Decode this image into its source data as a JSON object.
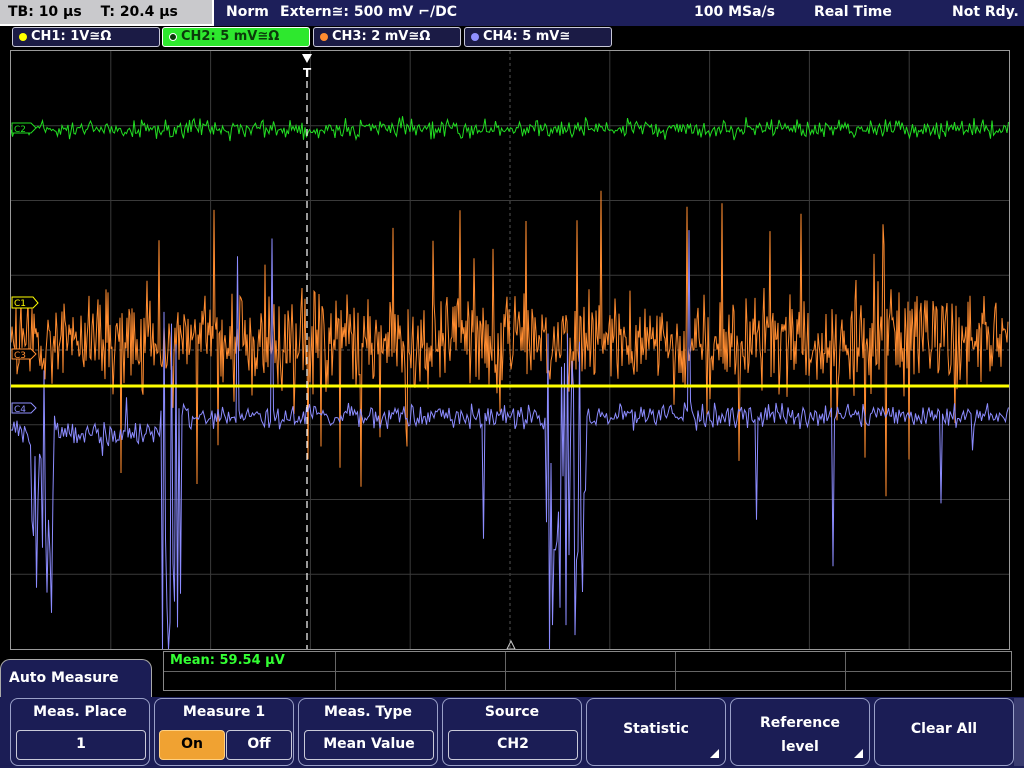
{
  "status_bar": {
    "timebase": "TB: 10 µs",
    "trigger_time": "T: 20.4 µs",
    "trigger_mode": "Norm",
    "trigger_source": "Extern≅: 500 mV ⌐/DC",
    "sample_rate": "100 MSa/s",
    "acquisition": "Real Time",
    "state": "Not Rdy."
  },
  "channels": [
    {
      "label": "CH1: 1V≅Ω",
      "color": "#ffff00",
      "active": false
    },
    {
      "label": "CH2: 5 mV≅Ω",
      "color": "#22dd22",
      "active": true
    },
    {
      "label": "CH3: 2 mV≅Ω",
      "color": "#ff8c30",
      "active": false
    },
    {
      "label": "CH4: 5 mV≅",
      "color": "#9090ff",
      "active": false
    }
  ],
  "markers": {
    "c2": "C2",
    "c1": "C1",
    "c3": "C3",
    "c4": "C4",
    "trigger": "T"
  },
  "measurement": {
    "mean": "Mean: 59.54 µV"
  },
  "panel": {
    "title": "Auto Measure",
    "meas_place": {
      "label": "Meas. Place",
      "value": "1"
    },
    "measure1": {
      "label": "Measure 1",
      "on": "On",
      "off": "Off"
    },
    "meas_type": {
      "label": "Meas. Type",
      "value": "Mean Value"
    },
    "source": {
      "label": "Source",
      "value": "CH2"
    },
    "statistic": {
      "label": "Statistic"
    },
    "reference": {
      "label_line1": "Reference",
      "label_line2": "level"
    },
    "clear_all": {
      "label": "Clear All"
    }
  },
  "colors": {
    "ch1": "#ffff00",
    "ch2": "#22dd22",
    "ch3": "#ff8c30",
    "ch4": "#8c8cff",
    "panel": "#1b1d55",
    "on_button": "#f0a232"
  }
}
